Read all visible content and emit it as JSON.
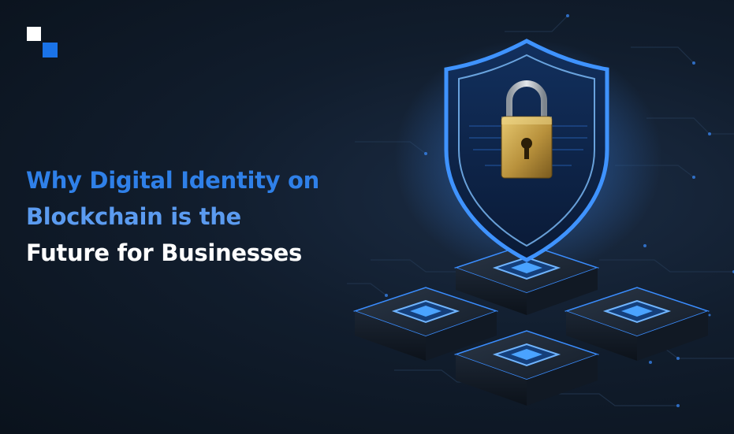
{
  "headline": {
    "line1": "Why Digital Identity on",
    "line2": "Blockchain is the",
    "line3": "Future for Businesses"
  },
  "colors": {
    "background": "#0f1a28",
    "accent_blue": "#2f80e8",
    "light_blue": "#5b9bf0",
    "glow": "#3a8dff",
    "lock_gold": "#c9a24a"
  },
  "icons": [
    "brand-logo-icon",
    "shield-icon",
    "padlock-icon",
    "blockchain-node-icon"
  ]
}
